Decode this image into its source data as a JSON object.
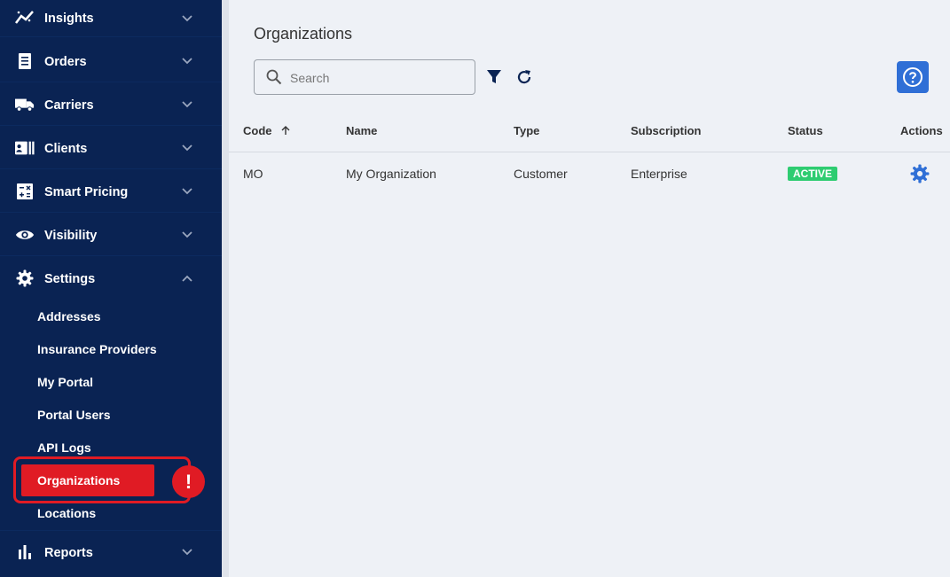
{
  "sidebar": {
    "items": [
      {
        "label": "Insights",
        "icon": "insights-icon"
      },
      {
        "label": "Orders",
        "icon": "orders-icon"
      },
      {
        "label": "Carriers",
        "icon": "truck-icon"
      },
      {
        "label": "Clients",
        "icon": "clients-icon"
      },
      {
        "label": "Smart Pricing",
        "icon": "calculator-icon"
      },
      {
        "label": "Visibility",
        "icon": "eye-icon"
      },
      {
        "label": "Settings",
        "icon": "gear-icon"
      }
    ],
    "settings_sub": [
      "Addresses",
      "Insurance Providers",
      "My Portal",
      "Portal Users",
      "API Logs",
      "Organizations",
      "Locations"
    ],
    "reports": {
      "label": "Reports",
      "icon": "bar-chart-icon"
    },
    "alert_glyph": "!"
  },
  "main": {
    "title": "Organizations",
    "search": {
      "placeholder": "Search",
      "value": ""
    },
    "table": {
      "headers": [
        "Code",
        "Name",
        "Type",
        "Subscription",
        "Status",
        "Actions"
      ],
      "rows": [
        {
          "code": "MO",
          "name": "My Organization",
          "type": "Customer",
          "subscription": "Enterprise",
          "status": "ACTIVE"
        }
      ]
    }
  },
  "colors": {
    "sidebar_bg": "#0a2353",
    "accent_red": "#e01b24",
    "primary_blue": "#2f6fd6",
    "status_active": "#2ecc71"
  }
}
